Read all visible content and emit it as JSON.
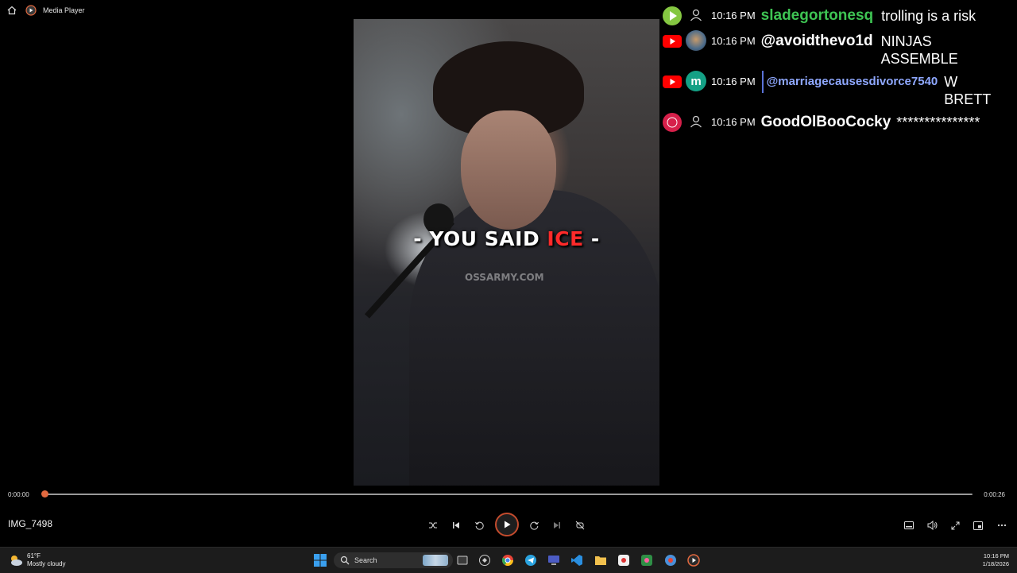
{
  "window": {
    "title": "Media Player"
  },
  "video": {
    "caption_part1": "- YOU SAID ",
    "caption_highlight": "ICE",
    "caption_part2": " -",
    "watermark": "OSSARMY.COM"
  },
  "chat": [
    {
      "platform": "rumble",
      "avatar": "user-icon",
      "time": "10:16 PM",
      "user": "sladegortonesq",
      "user_color": "#3ec453",
      "text": "trolling is a risk"
    },
    {
      "platform": "youtube",
      "avatar": "photo",
      "time": "10:16 PM",
      "user": "@avoidthevo1d",
      "user_color": "#ffffff",
      "text": "NINJAS ASSEMBLE"
    },
    {
      "platform": "youtube",
      "avatar": "m",
      "time": "10:16 PM",
      "user": "@marriagecausesdivorce7540",
      "user_color": "#8fa8ff",
      "text": "W BRETT"
    },
    {
      "platform": "other",
      "avatar": "user-icon",
      "time": "10:16 PM",
      "user": "GoodOlBooCocky",
      "user_color": "#ffffff",
      "text": "***************"
    }
  ],
  "player": {
    "current_time": "0:00:00",
    "duration": "0:00:26",
    "progress": 0,
    "file_name": "IMG_7498"
  },
  "taskbar": {
    "weather_temp": "61°F",
    "weather_desc": "Mostly cloudy",
    "search_label": "Search",
    "time": "10:16 PM",
    "date": "1/18/2026"
  },
  "colors": {
    "accent": "#e2693f",
    "rumble": "#85c742",
    "youtube": "#ff0000"
  }
}
